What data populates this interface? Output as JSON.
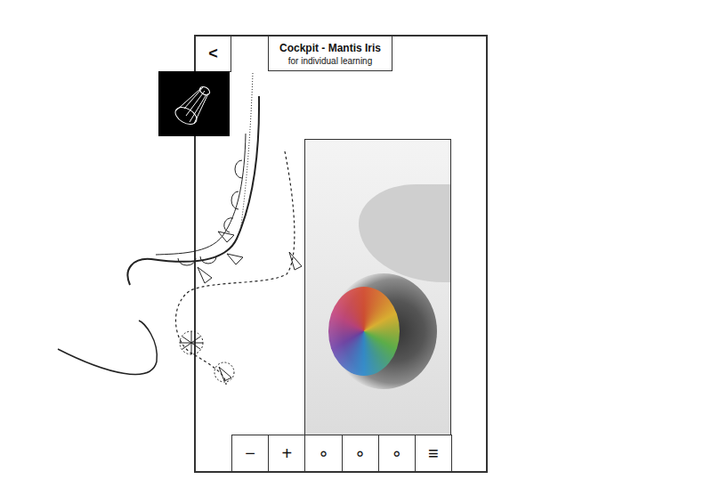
{
  "header": {
    "back": "<",
    "title": "Cockpit - Mantis Iris",
    "subtitle": "for individual learning"
  },
  "toolbar": [
    "−",
    "+",
    "∘",
    "∘",
    "∘",
    "≡"
  ]
}
